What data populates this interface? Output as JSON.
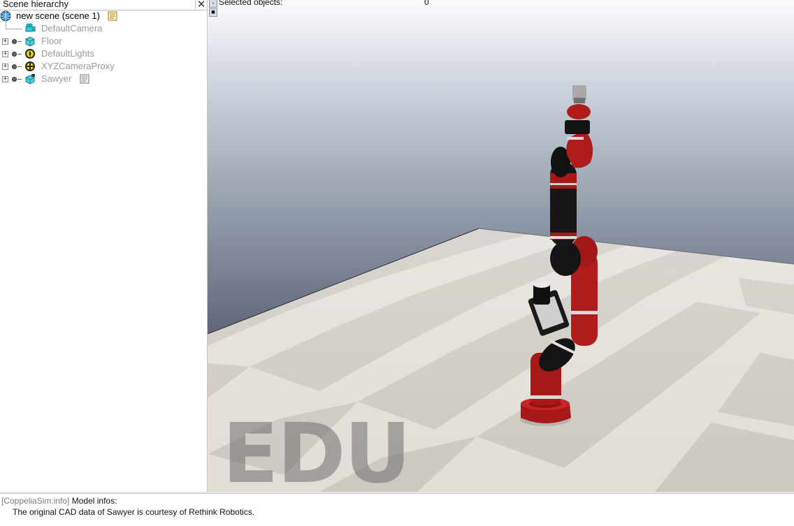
{
  "hierarchy": {
    "title": "Scene hierarchy",
    "close_glyph": "✕",
    "scene": {
      "label": "new scene (scene 1)",
      "icon": "globe-icon"
    },
    "items": [
      {
        "label": "DefaultCamera",
        "icon": "camera-icon",
        "expander": ""
      },
      {
        "label": "Floor",
        "icon": "cube-icon",
        "expander": "+"
      },
      {
        "label": "DefaultLights",
        "icon": "light-icon",
        "expander": "+"
      },
      {
        "label": "XYZCameraProxy",
        "icon": "dummy-icon",
        "expander": "+"
      },
      {
        "label": "Sawyer",
        "icon": "model-icon",
        "expander": "+"
      }
    ]
  },
  "viewport": {
    "selected_label": "Selected objects:",
    "selected_count": "0",
    "watermark": "EDU"
  },
  "status": {
    "prefix": "[CoppeliaSim:info]",
    "title": " Model infos:",
    "message": "The original CAD data of Sawyer is courtesy of Rethink Robotics."
  },
  "colors": {
    "robot_red": "#a81818",
    "robot_black": "#1a1a1a",
    "floor_light": "#e3ded7",
    "floor_dark": "#cfcac3",
    "info_prefix": "#7a7a7a"
  }
}
